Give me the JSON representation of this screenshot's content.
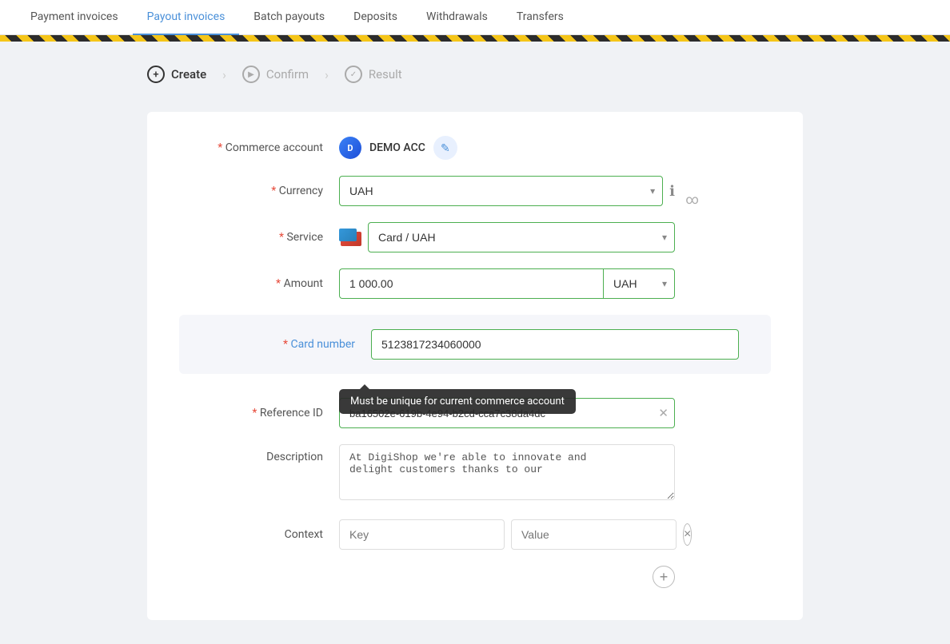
{
  "nav": {
    "items": [
      {
        "id": "payment-invoices",
        "label": "Payment invoices",
        "active": false
      },
      {
        "id": "payout-invoices",
        "label": "Payout invoices",
        "active": true
      },
      {
        "id": "batch-payouts",
        "label": "Batch payouts",
        "active": false
      },
      {
        "id": "deposits",
        "label": "Deposits",
        "active": false
      },
      {
        "id": "withdrawals",
        "label": "Withdrawals",
        "active": false
      },
      {
        "id": "transfers",
        "label": "Transfers",
        "active": false
      }
    ]
  },
  "wizard": {
    "steps": [
      {
        "id": "create",
        "label": "Create",
        "icon": "+",
        "active": true
      },
      {
        "id": "confirm",
        "label": "Confirm",
        "icon": "▶",
        "active": false
      },
      {
        "id": "result",
        "label": "Result",
        "icon": "✓",
        "active": false
      }
    ]
  },
  "form": {
    "commerce_account_label": "Commerce account",
    "commerce_account_name": "DEMO ACC",
    "currency_label": "Currency",
    "currency_value": "UAH",
    "service_label": "Service",
    "service_value": "Card / UAH",
    "amount_label": "Amount",
    "amount_value": "1 000.00",
    "amount_currency": "UAH",
    "card_number_label": "Card number",
    "card_number_value": "5123817234060000",
    "tooltip_text": "Must be unique for current commerce account",
    "reference_id_label": "Reference ID",
    "reference_id_value": "ba16502e-619b-4e94-b2cd-cca7c38da4dc",
    "description_label": "Description",
    "description_placeholder": "At DigiShop we're able to innovate and\ndelight customers thanks to our",
    "context_label": "Context",
    "context_key_placeholder": "Key",
    "context_value_placeholder": "Value"
  }
}
